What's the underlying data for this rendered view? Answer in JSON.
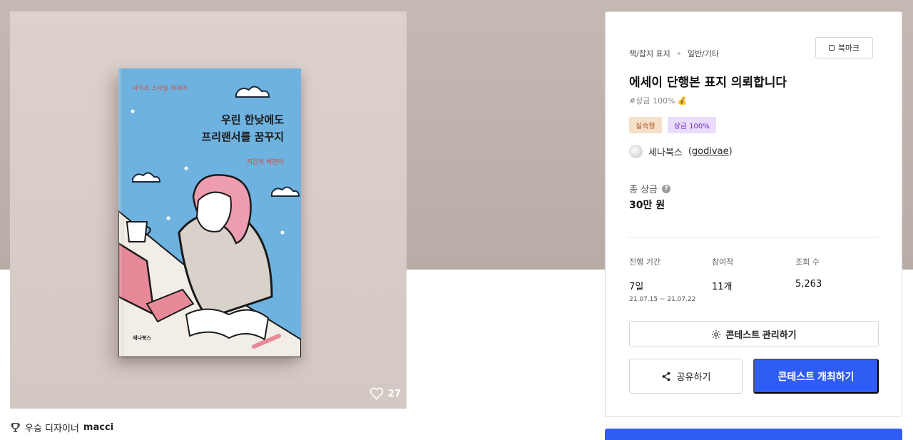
{
  "cover": {
    "book_label": "라이프 스타일 에세이",
    "book_title_line1": "우린 한낮에도",
    "book_title_line2": "프리랜서를 꿈꾸지",
    "book_author": "지은이 박현아",
    "book_publisher": "세나북스",
    "like_count": "27"
  },
  "winner": {
    "prefix": "우승 디자이너",
    "name": "macci"
  },
  "panel": {
    "category": "책/잡지 표지",
    "subcategory": "일반/기타",
    "bookmark_label": "북마크",
    "title": "에세이 단행본 표지 의뢰합니다",
    "tag": "#상금 100% 💰",
    "badges": [
      "실속형",
      "상금 100%"
    ],
    "host_name": "세나북스",
    "host_id": "godivae",
    "prize_label": "총 상금",
    "prize_value": "30만 원",
    "stats": [
      {
        "label": "진행 기간",
        "value": "7일",
        "sub": "21.07.15 ~ 21.07.22"
      },
      {
        "label": "참여작",
        "value": "11개",
        "sub": ""
      },
      {
        "label": "조회 수",
        "value": "5,263",
        "sub": ""
      }
    ],
    "manage_label": "콘테스트 관리하기",
    "share_label": "공유하기",
    "host_button_label": "콘테스트 개최하기"
  },
  "colors": {
    "accent": "#2f5cf4",
    "badge_orange_bg": "#f6dfca",
    "badge_purple_bg": "#eadcfc"
  }
}
